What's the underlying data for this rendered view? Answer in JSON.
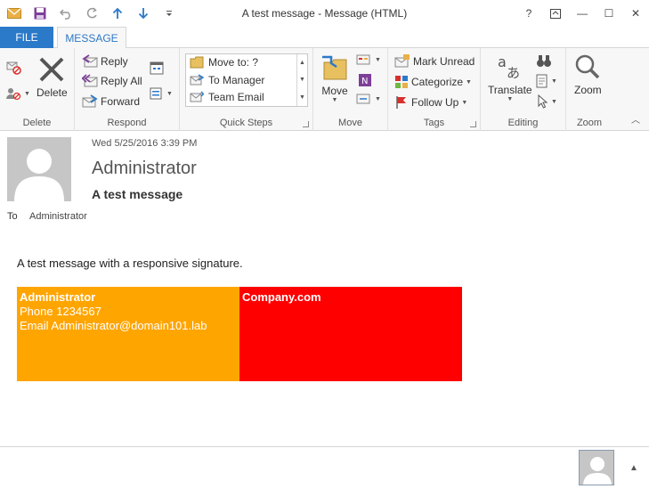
{
  "window": {
    "title": "A test message - Message (HTML)",
    "help": "?",
    "restore": "⧉",
    "minimize": "—",
    "maximize": "☐",
    "close": "✕"
  },
  "tabs": [
    {
      "label": "FILE"
    },
    {
      "label": "MESSAGE"
    }
  ],
  "ribbon": {
    "delete_group": {
      "label": "Delete",
      "delete_button": "Delete"
    },
    "respond_group": {
      "label": "Respond",
      "reply": "Reply",
      "reply_all": "Reply All",
      "forward": "Forward"
    },
    "quick_steps_group": {
      "label": "Quick Steps",
      "items": [
        "Move to: ?",
        "To Manager",
        "Team Email"
      ]
    },
    "move_group": {
      "label": "Move",
      "move_button": "Move"
    },
    "tags_group": {
      "label": "Tags",
      "mark_unread": "Mark Unread",
      "categorize": "Categorize",
      "follow_up": "Follow Up"
    },
    "editing_group": {
      "label": "Editing",
      "translate": "Translate"
    },
    "zoom_group": {
      "label": "Zoom",
      "zoom_button": "Zoom"
    }
  },
  "message": {
    "date": "Wed 5/25/2016 3:39 PM",
    "sender": "Administrator",
    "subject": "A test message",
    "to_label": "To",
    "to_value": "Administrator",
    "body_text": "A test message with a responsive signature."
  },
  "signature": {
    "name": "Administrator",
    "phone": "Phone 1234567",
    "email": "Email Administrator@domain101.lab",
    "company": "Company.com",
    "left_color": "#ffa500",
    "right_color": "#ff0000"
  },
  "colors": {
    "accent": "#2b79c9"
  }
}
